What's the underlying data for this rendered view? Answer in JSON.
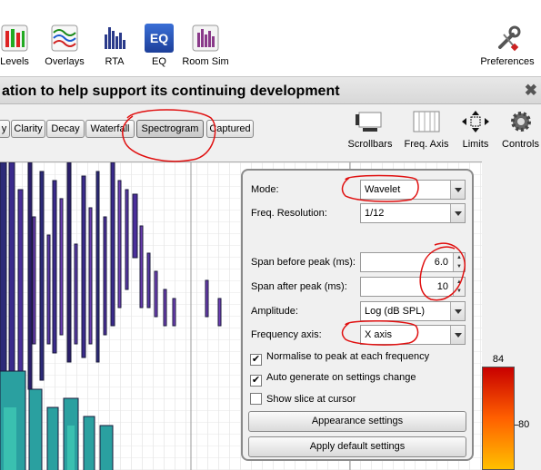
{
  "toolbar": {
    "items": [
      {
        "label": "Levels",
        "icon": "levels-icon"
      },
      {
        "label": "Overlays",
        "icon": "overlays-icon"
      },
      {
        "label": "RTA",
        "icon": "rta-icon"
      },
      {
        "label": "EQ",
        "icon": "eq-icon",
        "icon_text": "EQ"
      },
      {
        "label": "Room Sim",
        "icon": "room-sim-icon"
      },
      {
        "label": "Preferences",
        "icon": "wrench-screwdriver-icon"
      }
    ]
  },
  "banner": {
    "text": "ation to help support its continuing development",
    "close": "✖"
  },
  "tabs": [
    {
      "label": "y"
    },
    {
      "label": "Clarity"
    },
    {
      "label": "Decay"
    },
    {
      "label": "Waterfall"
    },
    {
      "label": "Spectrogram",
      "active": true
    },
    {
      "label": "Captured"
    }
  ],
  "right_tools": [
    {
      "label": "Scrollbars",
      "icon": "scrollbars-icon"
    },
    {
      "label": "Freq. Axis",
      "icon": "freq-axis-icon"
    },
    {
      "label": "Limits",
      "icon": "limits-arrows-icon"
    },
    {
      "label": "Controls",
      "icon": "gear-icon"
    }
  ],
  "panel": {
    "mode": {
      "label": "Mode:",
      "value": "Wavelet"
    },
    "freq_resolution": {
      "label": "Freq. Resolution:",
      "value": "1/12"
    },
    "span_before": {
      "label": "Span before peak (ms):",
      "value": "6.0"
    },
    "span_after": {
      "label": "Span after peak (ms):",
      "value": "10"
    },
    "amplitude": {
      "label": "Amplitude:",
      "value": "Log (dB SPL)"
    },
    "freq_axis": {
      "label": "Frequency axis:",
      "value": "X axis"
    },
    "checkboxes": [
      {
        "label": "Normalise to peak at each frequency",
        "checked": true,
        "mark": "✔"
      },
      {
        "label": "Auto generate on settings change",
        "checked": true,
        "mark": "✔"
      },
      {
        "label": "Show slice at cursor",
        "checked": false,
        "mark": ""
      }
    ],
    "appearance_button": "Appearance settings",
    "default_button": "Apply default settings"
  },
  "scale": {
    "top_label": "84",
    "mid_label": "80"
  },
  "colors": {
    "annotation": "#e01010",
    "scale_top": "#d00000",
    "scale_bottom": "#ffd000"
  }
}
